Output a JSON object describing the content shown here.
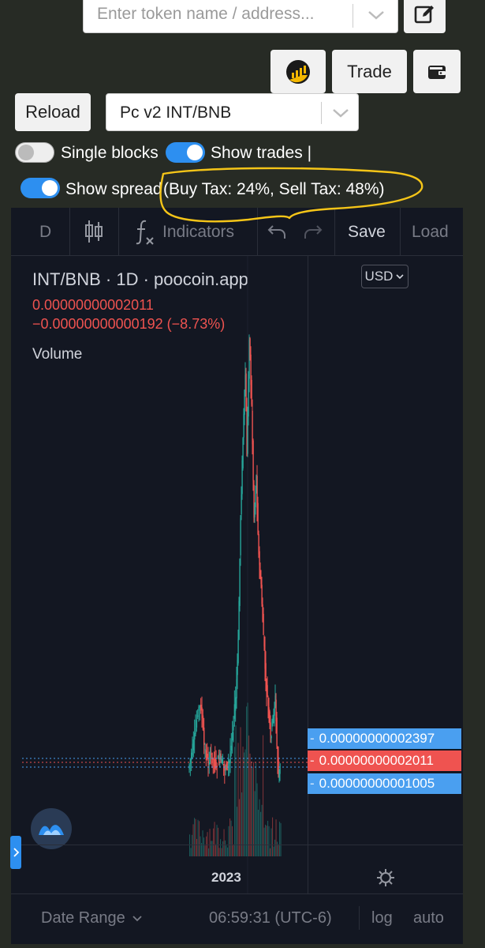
{
  "search": {
    "placeholder": "Enter token name / address..."
  },
  "toolbar": {
    "trade_label": "Trade",
    "reload_label": "Reload"
  },
  "pair_select": {
    "value": "Pc v2 INT/BNB"
  },
  "toggles": [
    {
      "label": "Single blocks",
      "on": false
    },
    {
      "label": "Show trades |",
      "on": true
    },
    {
      "label": "Show spread",
      "on": true
    }
  ],
  "tax_info": "(Buy Tax: 24%, Sell Tax: 48%)",
  "chart_toolbar": {
    "interval": "D",
    "indicators": "Indicators",
    "save": "Save",
    "load": "Load"
  },
  "legend": {
    "title": "INT/BNB · 1D · poocoin.app",
    "price": "0.00000000002011",
    "change": "−0.00000000000192 (−8.73%)",
    "volume_label": "Volume"
  },
  "currency": "USD",
  "price_tags": [
    {
      "value": "0.00000000002397",
      "color": "#4a9ff0"
    },
    {
      "value": "0.00000000002011",
      "color": "#ef5350"
    },
    {
      "value": "0.00000000001005",
      "color": "#4a9ff0"
    }
  ],
  "time_axis": {
    "label": "2023"
  },
  "footer": {
    "date_range": "Date Range",
    "time": "06:59:31 (UTC-6)",
    "log": "log",
    "auto": "auto"
  },
  "colors": {
    "up": "#26a69a",
    "down": "#ef5350",
    "accent": "#2d8ff0",
    "annotation": "#f5c518"
  },
  "icons": [
    "chevron-down-icon",
    "edit-icon",
    "chart-icon",
    "wallet-icon",
    "candles-icon",
    "fx-icon",
    "undo-icon",
    "redo-icon",
    "gear-icon",
    "logo-icon",
    "sidebar-chevron-icon"
  ]
}
